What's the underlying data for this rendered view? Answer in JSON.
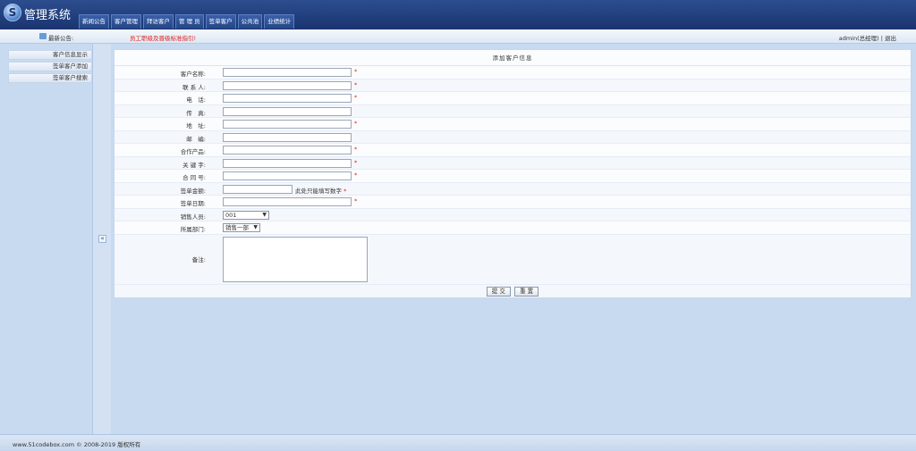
{
  "header": {
    "title": "管理系统",
    "nav": [
      "新闻公告",
      "客户管理",
      "拜访客户",
      "管 理 员",
      "签单客户",
      "公共池",
      "业绩统计"
    ]
  },
  "notice": {
    "label": "最新公告:",
    "text": "员工职级及晋级标准指引!",
    "user": "admin(总经理) | 退出"
  },
  "sidebar": {
    "items": [
      "客户信息显示",
      "签单客户添加",
      "签单客户搜索"
    ],
    "collapse": "«"
  },
  "form": {
    "title": "添加客户信息",
    "rows": [
      {
        "label": "客户名称:",
        "required": "*"
      },
      {
        "label": "联 系 人:",
        "required": "*"
      },
      {
        "label": "电　话:",
        "required": "*"
      },
      {
        "label": "传　真:",
        "required": ""
      },
      {
        "label": "地　址:",
        "required": "*"
      },
      {
        "label": "邮　编:",
        "required": ""
      },
      {
        "label": "合作产品:",
        "required": "*"
      },
      {
        "label": "关 键 字:",
        "required": "*"
      },
      {
        "label": "合 同 号:",
        "required": "*"
      }
    ],
    "amount": {
      "label": "签单金额:",
      "hint": "此处只能填写数字",
      "required": "*"
    },
    "date": {
      "label": "签单日期:",
      "required": "*"
    },
    "salesperson": {
      "label": "销售人员:",
      "value": "001"
    },
    "department": {
      "label": "所属部门:",
      "value": "销售一部"
    },
    "remark": {
      "label": "备注:"
    },
    "submit": "提 交",
    "reset": "重 置"
  },
  "footer": {
    "copyright": "www.51codebox.com © 2008-2019 版权所有"
  },
  "colors": {
    "header": "#1f3c7a",
    "accent_red": "#e0201c",
    "background": "#c8daf0"
  }
}
